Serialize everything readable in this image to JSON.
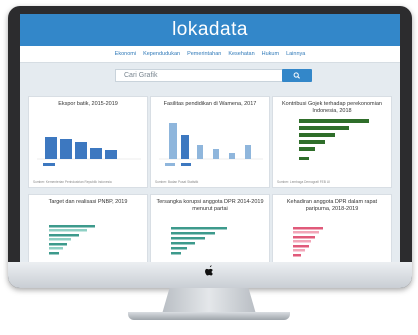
{
  "app": {
    "logo": "lokadata",
    "nav": [
      "Ekonomi",
      "Kependudukan",
      "Pemerintahan",
      "Kesehatan",
      "Hukum",
      "Lainnya"
    ],
    "search": {
      "placeholder": "Cari Grafik"
    }
  },
  "cards": [
    {
      "title": "Ekspor batik, 2015-2019",
      "subtitle": "",
      "source": "Sumber: Kementerian Perindustrian Republik Indonesia"
    },
    {
      "title": "Fasilitas pendidikan di Wamena, 2017",
      "subtitle": "",
      "source": "Sumber: Badan Pusat Statistik"
    },
    {
      "title": "Kontribusi Gojek terhadap perekonomian Indonesia, 2018",
      "subtitle": "",
      "source": "Sumber: Lembaga Demografi FEB UI"
    },
    {
      "title": "Target dan realisasi PNBP, 2019",
      "subtitle": "",
      "source": ""
    },
    {
      "title": "Tersangka korupsi anggota DPR 2014-2019 menurut partai",
      "subtitle": "",
      "source": ""
    },
    {
      "title": "Kehadiran anggota DPR dalam rapat paripurna, 2018-2019",
      "subtitle": "",
      "source": ""
    }
  ],
  "colors": {
    "header": "#3387c9",
    "screen_bg": "#e5ebf0",
    "bar_blue": "#3d78c0",
    "bar_lightblue": "#8fb6dc",
    "bar_green": "#2f6e2a",
    "bar_teal": "#3d9a8c",
    "bar_pink": "#e05a7a"
  },
  "icons": {
    "search_button": "search-icon",
    "brand": "apple-logo-icon"
  }
}
